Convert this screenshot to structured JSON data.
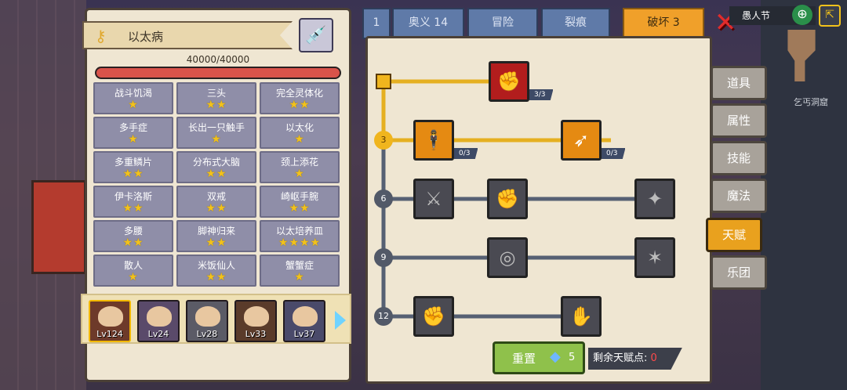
{
  "left_panel": {
    "disease_title": "以太病",
    "hp_text": "40000/40000",
    "hp_fraction": 1.0,
    "traits": [
      {
        "name": "战斗饥渴",
        "stars": 1
      },
      {
        "name": "三头",
        "stars": 2
      },
      {
        "name": "完全灵体化",
        "stars": 2
      },
      {
        "name": "多手症",
        "stars": 1
      },
      {
        "name": "长出一只触手",
        "stars": 1
      },
      {
        "name": "以太化",
        "stars": 1
      },
      {
        "name": "多重鳞片",
        "stars": 2
      },
      {
        "name": "分布式大脑",
        "stars": 2
      },
      {
        "name": "颈上添花",
        "stars": 1
      },
      {
        "name": "伊卡洛斯",
        "stars": 2
      },
      {
        "name": "双戒",
        "stars": 2
      },
      {
        "name": "崎岖手腕",
        "stars": 2
      },
      {
        "name": "多腰",
        "stars": 2
      },
      {
        "name": "脚神归来",
        "stars": 2
      },
      {
        "name": "以太培养皿",
        "stars": 4
      },
      {
        "name": "散人",
        "stars": 1
      },
      {
        "name": "米饭仙人",
        "stars": 2
      },
      {
        "name": "蟹蟹症",
        "stars": 1
      }
    ],
    "heroes": [
      {
        "level": "Lv124",
        "selected": true,
        "color": "#6d3a2a"
      },
      {
        "level": "Lv24",
        "selected": false,
        "color": "#5a4a6a"
      },
      {
        "level": "Lv28",
        "selected": false,
        "color": "#5b5b66"
      },
      {
        "level": "Lv33",
        "selected": false,
        "color": "#5a3b2a"
      },
      {
        "level": "Lv37",
        "selected": false,
        "color": "#4a4a6a"
      }
    ]
  },
  "tabs": [
    {
      "label": "1"
    },
    {
      "label": "奥义 14"
    },
    {
      "label": "冒险"
    },
    {
      "label": "裂痕"
    },
    {
      "label": "破坏 3"
    }
  ],
  "tree": {
    "levels": [
      "3",
      "6",
      "9",
      "12"
    ],
    "nodes": [
      {
        "name": "arm-wrestle",
        "count": "3/3",
        "style": "red",
        "icon": "✊"
      },
      {
        "name": "muscle",
        "count": "0/3",
        "style": "gold",
        "icon": "🕴"
      },
      {
        "name": "arrow-burst",
        "count": "0/3",
        "style": "gold",
        "icon": "➶"
      },
      {
        "name": "slash-card",
        "count": "",
        "style": "gray",
        "icon": "⚔"
      },
      {
        "name": "punch",
        "count": "",
        "style": "gray",
        "icon": "✊"
      },
      {
        "name": "spear-strike",
        "count": "",
        "style": "gray",
        "icon": "✦"
      },
      {
        "name": "ripple",
        "count": "",
        "style": "gray",
        "icon": "◎"
      },
      {
        "name": "bat-wings",
        "count": "",
        "style": "gray",
        "icon": "✶"
      },
      {
        "name": "fist",
        "count": "",
        "style": "gray",
        "icon": "✊"
      },
      {
        "name": "gauntlet",
        "count": "",
        "style": "gray",
        "icon": "✋"
      }
    ],
    "reset_label": "重置",
    "reset_cost": "5",
    "points_label": "剩余天赋点:",
    "points_value": "0"
  },
  "side_menu": [
    {
      "label": "道具"
    },
    {
      "label": "属性"
    },
    {
      "label": "技能"
    },
    {
      "label": "魔法"
    },
    {
      "label": "天赋"
    },
    {
      "label": "乐团"
    }
  ],
  "top_right": {
    "event_text": "愚人节",
    "location": "乞丐洞窟"
  }
}
